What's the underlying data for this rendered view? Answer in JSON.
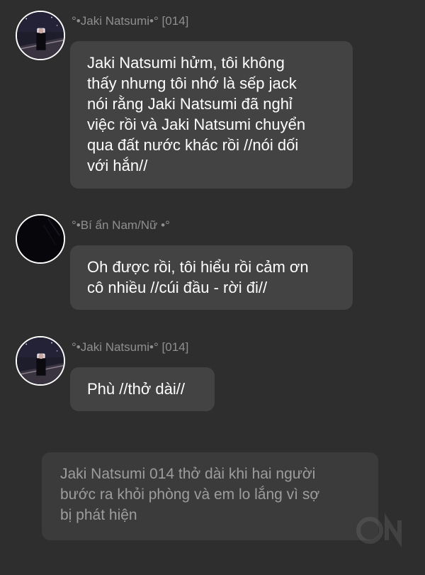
{
  "messages": [
    {
      "sender": "°•Jaki Natsumi•° [014]",
      "avatar": "character-avatar-icon",
      "text": "Jaki Natsumi hửm, tôi không\nthấy nhưng tôi nhớ là sếp jack\nnói rằng Jaki Natsumi đã nghỉ\nviệc rồi và Jaki Natsumi chuyển\nqua đất nước khác rồi //nói dối\nvới hắn//"
    },
    {
      "sender": "°•Bí ẩn Nam/Nữ •°",
      "avatar": "dark-avatar-icon",
      "text": "Oh được rồi, tôi hiểu rồi cảm ơn\ncô nhiều //cúi đầu - rời đi//"
    },
    {
      "sender": "°•Jaki Natsumi•° [014]",
      "avatar": "character-avatar-icon",
      "text": "Phù //thở dài//"
    }
  ],
  "narration": "Jaki Natsumi 014 thở dài khi hai người\nbước ra khỏi phòng và em lo lắng vì sợ\nbị phát hiện",
  "colors": {
    "background": "#2e2e2e",
    "bubble": "#434343",
    "narration_bubble": "#3b3b3b",
    "sender_text": "#8f8f8f"
  }
}
